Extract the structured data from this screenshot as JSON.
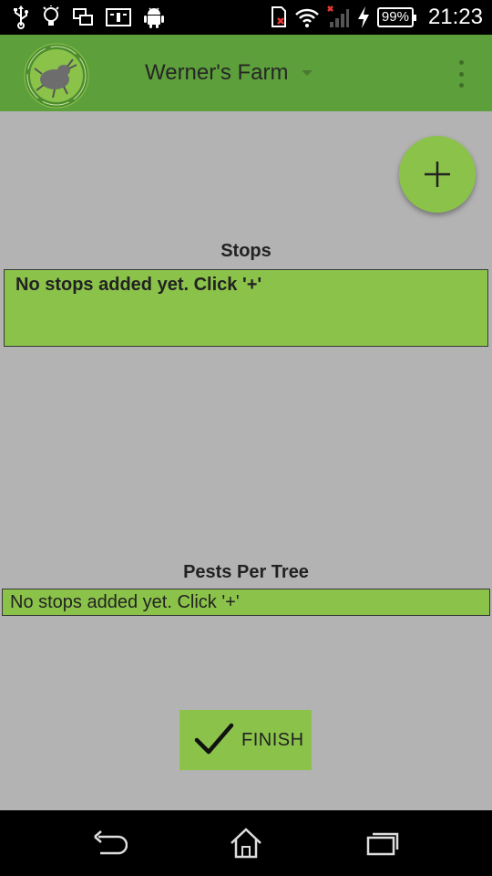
{
  "status_bar": {
    "battery": "99%",
    "time": "21:23",
    "left_icons": [
      "usb-icon",
      "lightbulb-icon",
      "screen-mirror-icon",
      "id-card-icon",
      "android-icon"
    ],
    "right_icons": [
      "sd-card-icon",
      "wifi-icon",
      "signal-icon",
      "charging-icon"
    ]
  },
  "app_bar": {
    "title": "Werner's Farm",
    "logo_text": "SANBUG",
    "color": "#5d9f3b"
  },
  "fab": {
    "label": "+",
    "color": "#8bc34a"
  },
  "stops": {
    "heading": "Stops",
    "empty_message": "No stops added yet. Click '+'"
  },
  "pests": {
    "heading": "Pests Per Tree",
    "empty_message": "No stops added yet. Click '+'"
  },
  "finish_button": {
    "label": "FINISH"
  },
  "nav_bar": {
    "icons": [
      "back-icon",
      "home-icon",
      "recent-apps-icon"
    ]
  },
  "colors": {
    "background": "#b3b3b3",
    "accent": "#8bc34a",
    "appbar": "#5d9f3b"
  }
}
